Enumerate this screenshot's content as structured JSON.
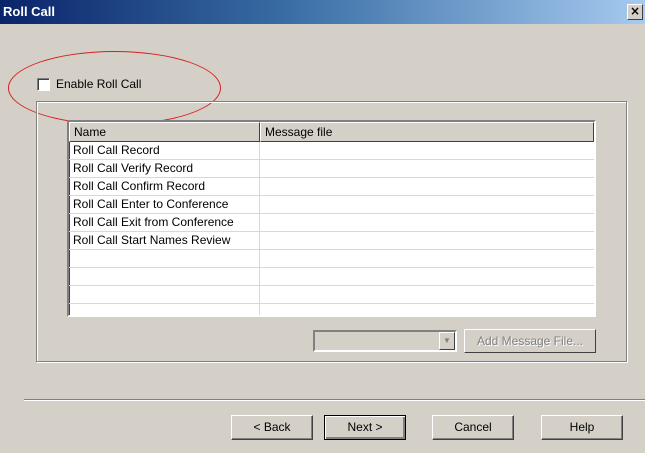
{
  "window": {
    "title": "Roll Call",
    "close_glyph": "×",
    "close_icon": "close-icon"
  },
  "enable": {
    "label": "Enable Roll Call",
    "checked": false
  },
  "list": {
    "columns": [
      "Name",
      "Message file"
    ],
    "rows": [
      {
        "name": "Roll Call Record",
        "file": ""
      },
      {
        "name": "Roll Call Verify Record",
        "file": ""
      },
      {
        "name": "Roll Call Confirm Record",
        "file": ""
      },
      {
        "name": "Roll Call Enter to Conference",
        "file": ""
      },
      {
        "name": "Roll Call Exit from Conference",
        "file": ""
      },
      {
        "name": "Roll Call Start Names Review",
        "file": ""
      },
      {
        "name": "",
        "file": ""
      },
      {
        "name": "",
        "file": ""
      },
      {
        "name": "",
        "file": ""
      },
      {
        "name": "",
        "file": ""
      }
    ]
  },
  "combo": {
    "value": "",
    "arrow_glyph": "▼",
    "arrow_icon": "chevron-down-icon"
  },
  "add_button": {
    "label": "Add Message File...",
    "enabled": false
  },
  "footer": {
    "back": "< Back",
    "next": "Next >",
    "cancel": "Cancel",
    "help": "Help"
  },
  "colors": {
    "title_start": "#0a246a",
    "title_end": "#a6caf0",
    "annotation": "#d62020",
    "face": "#d4d0c8"
  }
}
